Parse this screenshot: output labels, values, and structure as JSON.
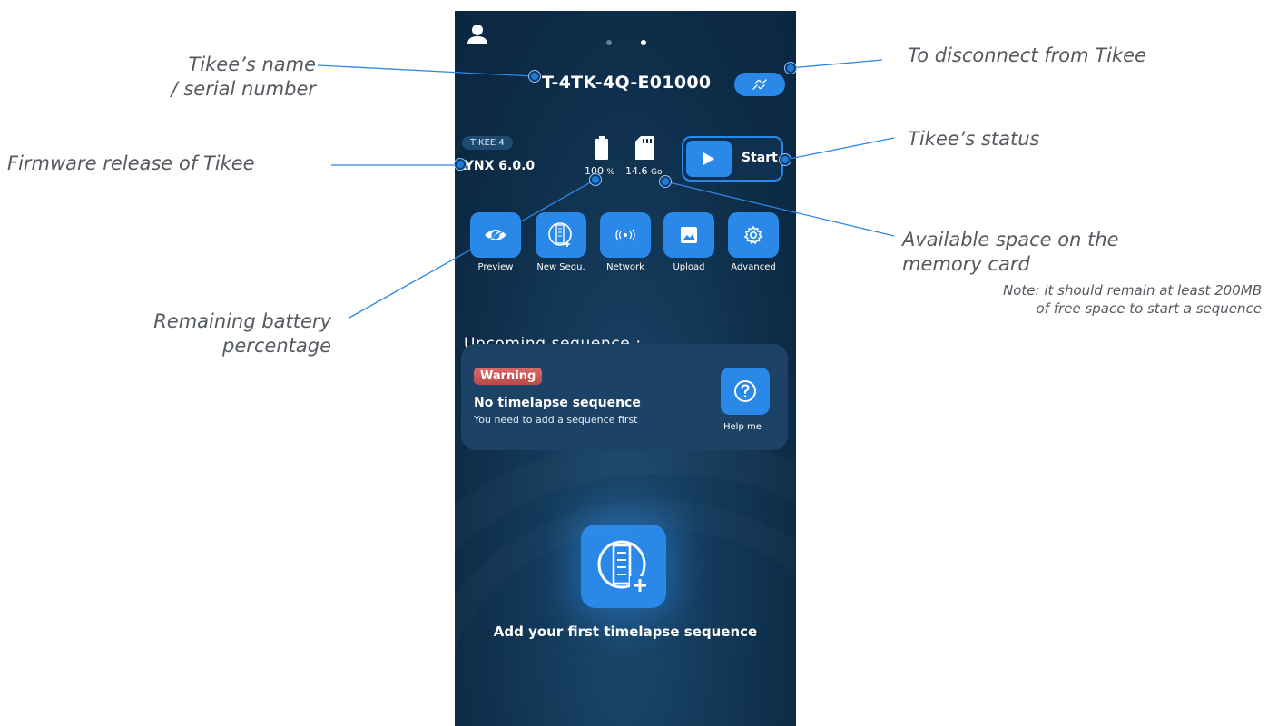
{
  "app": {
    "page_indicator": {
      "count": 2,
      "active": 2
    },
    "device": {
      "serial": "T-4TK-4Q-E01000",
      "model_badge": "TIKEE 4",
      "firmware": "LYNX 6.0.0",
      "battery_value": "100",
      "battery_unit": "%",
      "storage_value": "14.6",
      "storage_unit": "Go"
    },
    "status_button": {
      "label": "Start"
    },
    "actions": [
      {
        "label": "Preview",
        "icon": "eye-icon"
      },
      {
        "label": "New Sequ.",
        "icon": "film-add-icon"
      },
      {
        "label": "Network",
        "icon": "signal-icon"
      },
      {
        "label": "Upload",
        "icon": "image-icon"
      },
      {
        "label": "Advanced",
        "icon": "gear-icon"
      }
    ],
    "upcoming": {
      "title": "Upcoming sequence :",
      "warning_badge": "Warning",
      "warning_title": "No timelapse sequence",
      "warning_text": "You need to add a sequence first",
      "help_label": "Help me"
    },
    "add_sequence_label": "Add your first timelapse sequence"
  },
  "annotations": {
    "name_line1": "Tikee’s name",
    "name_line2": "/ serial number",
    "firmware": "Firmware release of Tikee",
    "battery_line1": "Remaining battery",
    "battery_line2": "percentage",
    "disconnect": "To disconnect from Tikee",
    "status": "Tikee’s status",
    "space_line1": "Available space on the",
    "space_line2": "memory card",
    "note_line1": "Note: it should remain at least 200MB",
    "note_line2": "of free space to start a sequence"
  },
  "colors": {
    "accent": "#2a88e8",
    "background": "#0d2c47",
    "card": "#1c4366",
    "warning": "#c85a5a",
    "annotation_text": "#555a60"
  }
}
